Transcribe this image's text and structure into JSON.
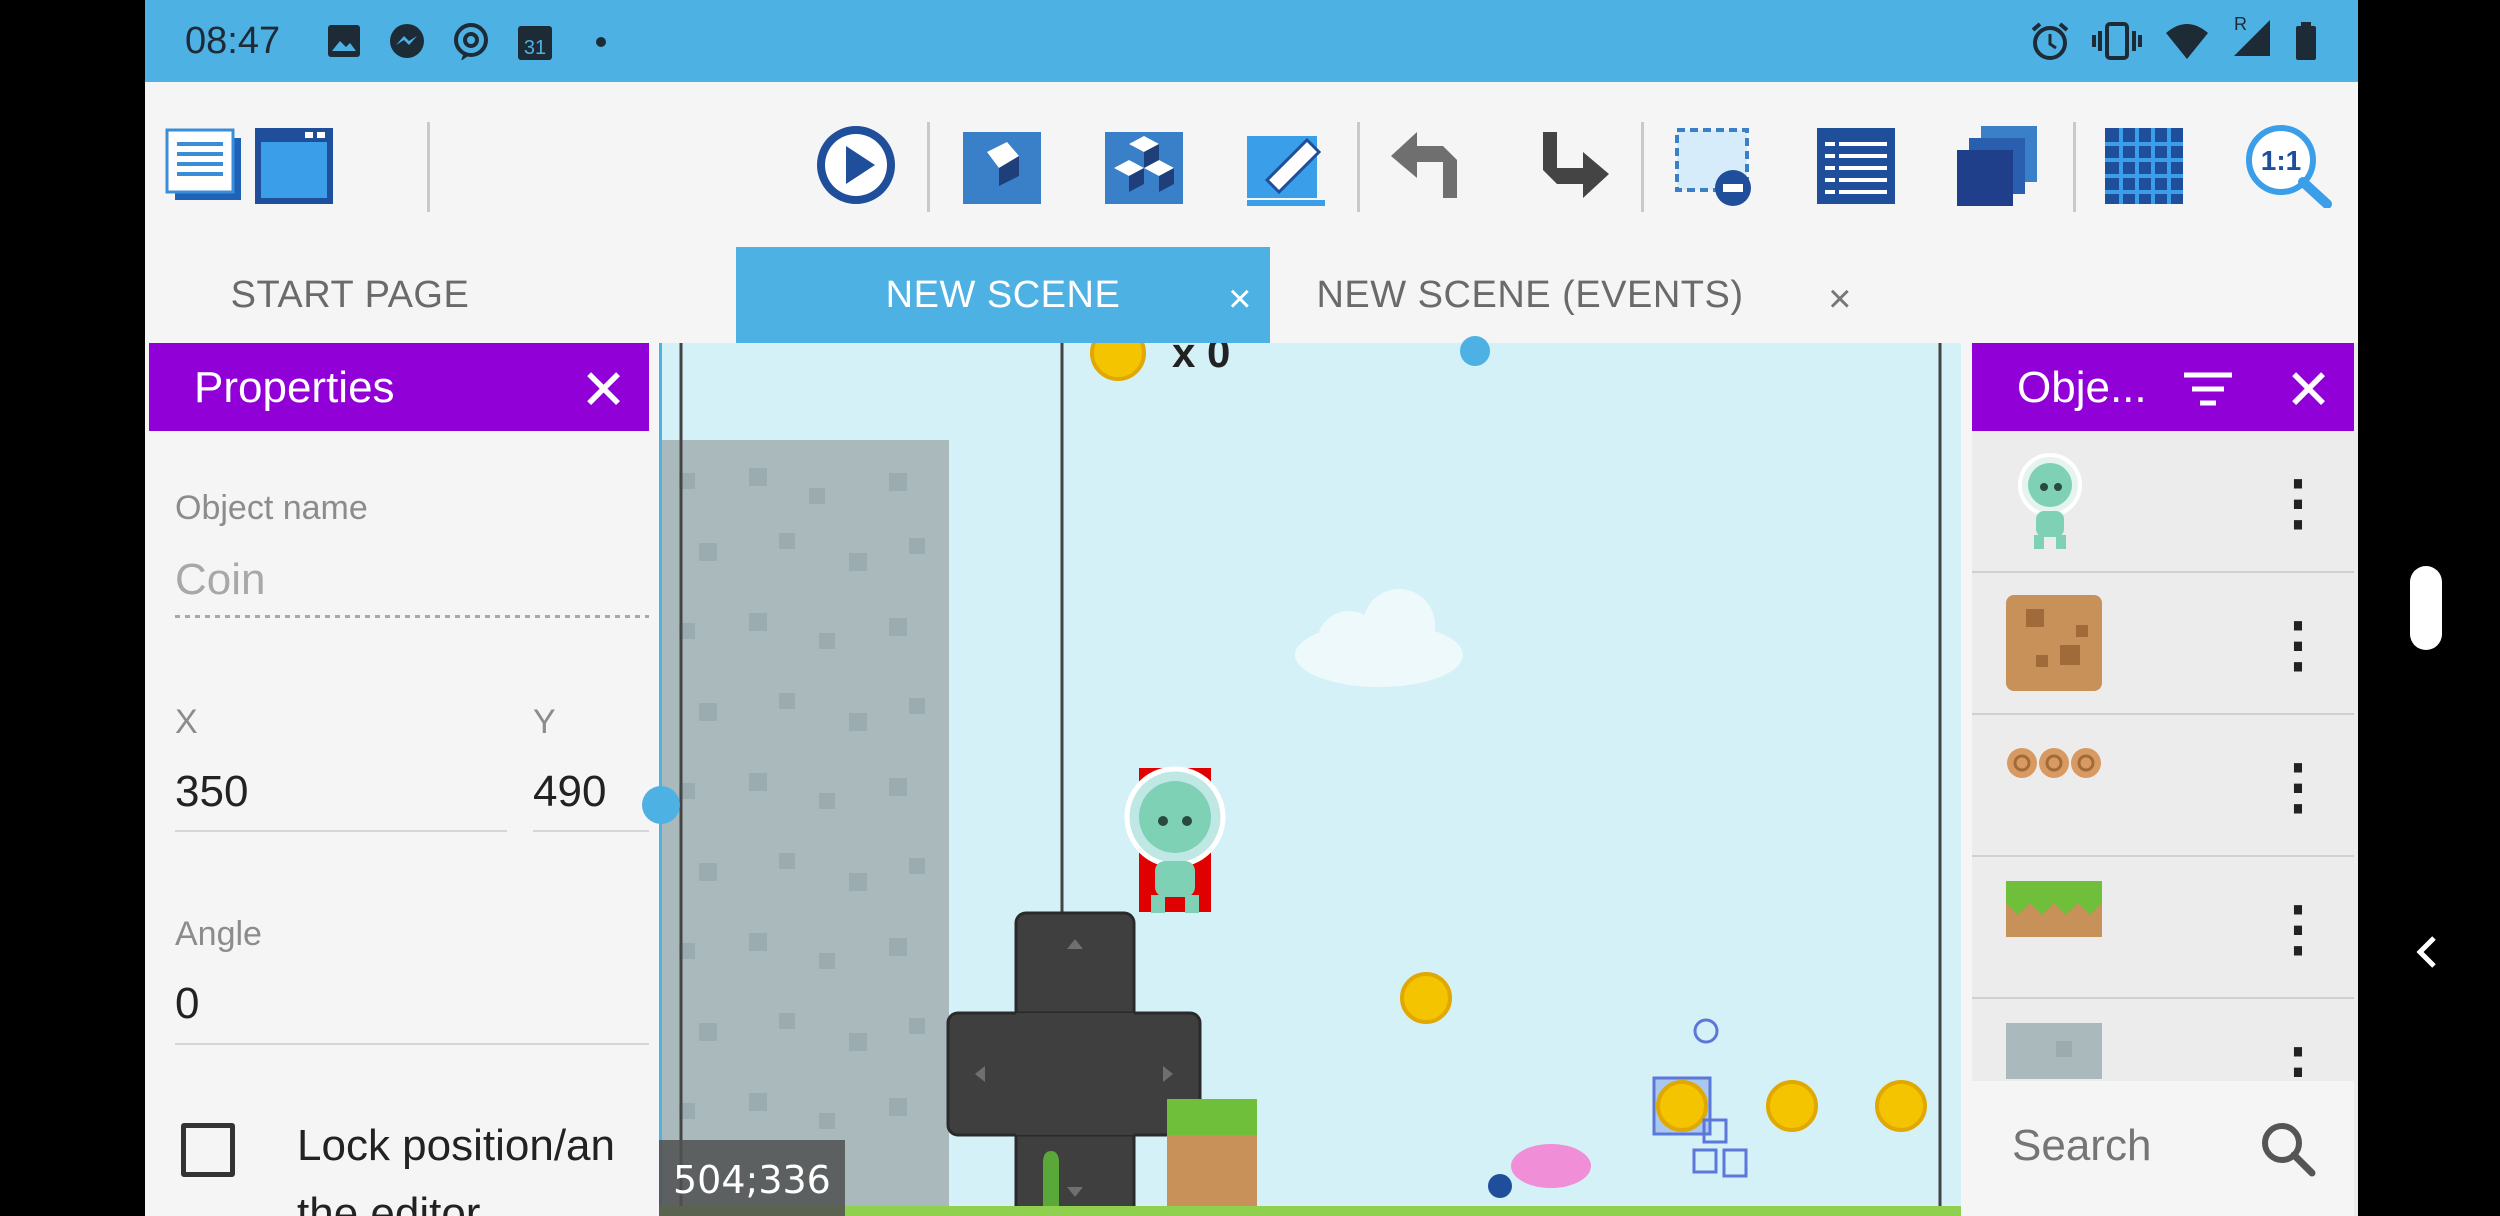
{
  "status_bar": {
    "time": "08:47",
    "calendar_day": "31",
    "signal_badge": "R",
    "left_icons": [
      "image-icon",
      "messenger-icon",
      "at-icon",
      "calendar-icon",
      "dot-icon"
    ],
    "right_icons": [
      "alarm-icon",
      "vibrate-icon",
      "wifi-icon",
      "signal-icon",
      "battery-icon"
    ]
  },
  "toolbar": {
    "zoom_label": "1:1",
    "icons": [
      "project-manager-icon",
      "scene-window-icon",
      "preview-play-icon",
      "edit-object-icon",
      "edit-groups-icon",
      "edit-layers-icon",
      "undo-icon",
      "redo-icon",
      "deselect-icon",
      "instances-list-icon",
      "layers-icon",
      "grid-icon",
      "zoom-reset-icon"
    ]
  },
  "tabs": [
    {
      "label": "START PAGE",
      "closable": false,
      "active": false
    },
    {
      "label": "NEW SCENE",
      "closable": true,
      "active": true
    },
    {
      "label": "NEW SCENE (EVENTS)",
      "closable": true,
      "active": false
    }
  ],
  "tab_close_glyph": "×",
  "properties": {
    "title": "Properties",
    "object_name_label": "Object name",
    "object_name_value": "Coin",
    "x_label": "X",
    "x_value": "350",
    "y_label": "Y",
    "y_value": "490",
    "angle_label": "Angle",
    "angle_value": "0",
    "lock_label": "Lock position/an",
    "lock_label_line2": "the editor",
    "lock_checked": false
  },
  "canvas": {
    "coords": "504;336",
    "hud_text": "x 0"
  },
  "objects_panel": {
    "title": "Obje...",
    "items": [
      "alien-player",
      "dirt-block",
      "log-platform",
      "grass-ground",
      "stone-wall"
    ],
    "search_placeholder": "Search"
  },
  "colors": {
    "status_bar": "#4eb1e3",
    "accent_purple": "#9100d6",
    "tab_active": "#4eb1e3",
    "canvas_sky": "#d4f1f7"
  }
}
